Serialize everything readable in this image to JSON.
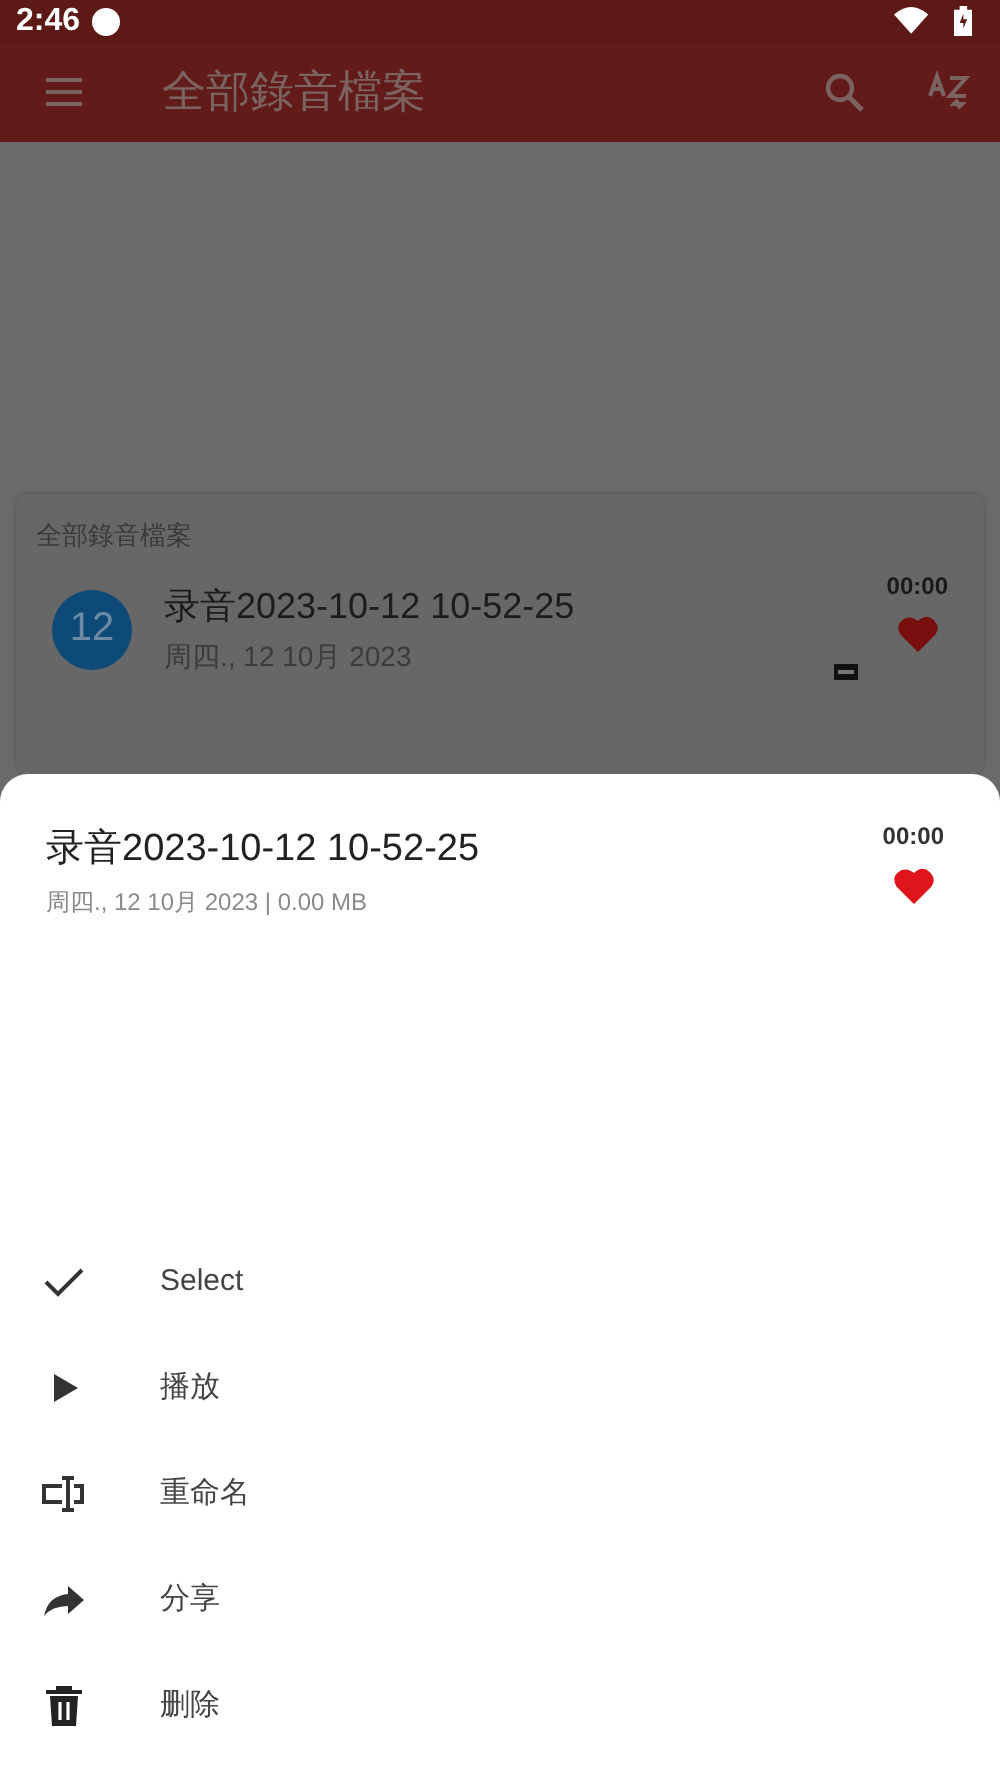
{
  "status_bar": {
    "time": "2:46"
  },
  "app_bar": {
    "title": "全部錄音檔案"
  },
  "list": {
    "header": "全部錄音檔案",
    "items": [
      {
        "badge": "12",
        "title": "录音2023-10-12 10-52-25",
        "subtitle": "周四., 12 10月 2023",
        "duration": "00:00",
        "favorite": true
      }
    ]
  },
  "sheet": {
    "title": "录音2023-10-12 10-52-25",
    "subtitle": "周四., 12 10月 2023 | 0.00 MB",
    "duration": "00:00",
    "favorite": true,
    "actions": [
      {
        "kind": "check",
        "label": "Select"
      },
      {
        "kind": "play",
        "label": "播放"
      },
      {
        "kind": "rename",
        "label": "重命名"
      },
      {
        "kind": "share",
        "label": "分享"
      },
      {
        "kind": "delete",
        "label": "删除"
      }
    ]
  }
}
